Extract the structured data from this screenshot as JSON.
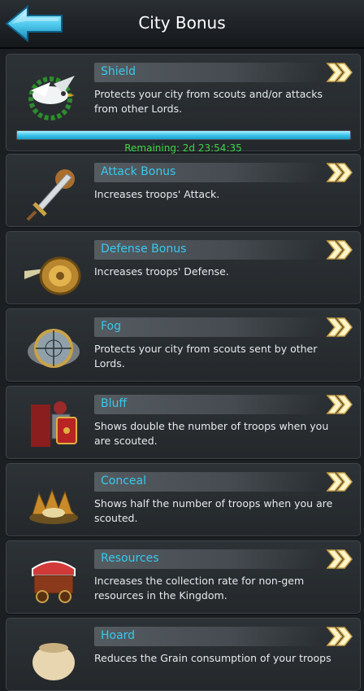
{
  "header": {
    "title": "City Bonus"
  },
  "bonuses": [
    {
      "name": "Shield",
      "desc": "Protects your city from scouts and/or attacks from other Lords."
    },
    {
      "name": "Attack Bonus",
      "desc": "Increases troops' Attack."
    },
    {
      "name": "Defense Bonus",
      "desc": "Increases troops' Defense."
    },
    {
      "name": "Fog",
      "desc": "Protects your city from scouts sent by other Lords."
    },
    {
      "name": "Bluff",
      "desc": "Shows double the number of troops when you are scouted."
    },
    {
      "name": "Conceal",
      "desc": "Shows half the number of troops when you are scouted."
    },
    {
      "name": "Resources",
      "desc": "Increases the collection rate for non-gem resources in the Kingdom."
    },
    {
      "name": "Hoard",
      "desc": "Reduces the Grain consumption of your troops"
    }
  ],
  "shield_timer": {
    "remaining": "Remaining: 2d 23:54:35",
    "progress_fraction": 1.0
  },
  "colors": {
    "name_text": "#38c8ee",
    "remaining_text": "#3fd34a",
    "progress": "#3fc6ec"
  }
}
